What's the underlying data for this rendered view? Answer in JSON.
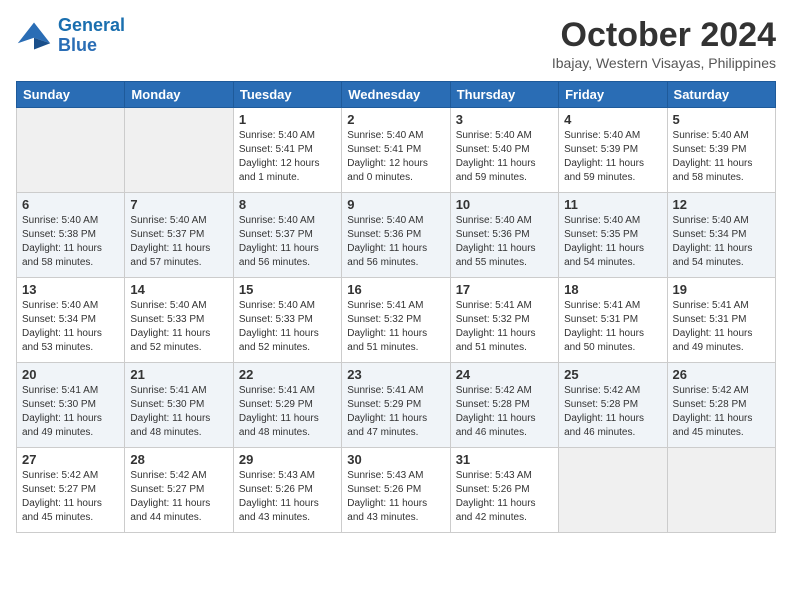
{
  "logo": {
    "line1": "General",
    "line2": "Blue"
  },
  "title": "October 2024",
  "location": "Ibajay, Western Visayas, Philippines",
  "days_of_week": [
    "Sunday",
    "Monday",
    "Tuesday",
    "Wednesday",
    "Thursday",
    "Friday",
    "Saturday"
  ],
  "weeks": [
    [
      {
        "day": "",
        "empty": true
      },
      {
        "day": "",
        "empty": true
      },
      {
        "day": "1",
        "sunrise": "Sunrise: 5:40 AM",
        "sunset": "Sunset: 5:41 PM",
        "daylight": "Daylight: 12 hours and 1 minute."
      },
      {
        "day": "2",
        "sunrise": "Sunrise: 5:40 AM",
        "sunset": "Sunset: 5:41 PM",
        "daylight": "Daylight: 12 hours and 0 minutes."
      },
      {
        "day": "3",
        "sunrise": "Sunrise: 5:40 AM",
        "sunset": "Sunset: 5:40 PM",
        "daylight": "Daylight: 11 hours and 59 minutes."
      },
      {
        "day": "4",
        "sunrise": "Sunrise: 5:40 AM",
        "sunset": "Sunset: 5:39 PM",
        "daylight": "Daylight: 11 hours and 59 minutes."
      },
      {
        "day": "5",
        "sunrise": "Sunrise: 5:40 AM",
        "sunset": "Sunset: 5:39 PM",
        "daylight": "Daylight: 11 hours and 58 minutes."
      }
    ],
    [
      {
        "day": "6",
        "sunrise": "Sunrise: 5:40 AM",
        "sunset": "Sunset: 5:38 PM",
        "daylight": "Daylight: 11 hours and 58 minutes."
      },
      {
        "day": "7",
        "sunrise": "Sunrise: 5:40 AM",
        "sunset": "Sunset: 5:37 PM",
        "daylight": "Daylight: 11 hours and 57 minutes."
      },
      {
        "day": "8",
        "sunrise": "Sunrise: 5:40 AM",
        "sunset": "Sunset: 5:37 PM",
        "daylight": "Daylight: 11 hours and 56 minutes."
      },
      {
        "day": "9",
        "sunrise": "Sunrise: 5:40 AM",
        "sunset": "Sunset: 5:36 PM",
        "daylight": "Daylight: 11 hours and 56 minutes."
      },
      {
        "day": "10",
        "sunrise": "Sunrise: 5:40 AM",
        "sunset": "Sunset: 5:36 PM",
        "daylight": "Daylight: 11 hours and 55 minutes."
      },
      {
        "day": "11",
        "sunrise": "Sunrise: 5:40 AM",
        "sunset": "Sunset: 5:35 PM",
        "daylight": "Daylight: 11 hours and 54 minutes."
      },
      {
        "day": "12",
        "sunrise": "Sunrise: 5:40 AM",
        "sunset": "Sunset: 5:34 PM",
        "daylight": "Daylight: 11 hours and 54 minutes."
      }
    ],
    [
      {
        "day": "13",
        "sunrise": "Sunrise: 5:40 AM",
        "sunset": "Sunset: 5:34 PM",
        "daylight": "Daylight: 11 hours and 53 minutes."
      },
      {
        "day": "14",
        "sunrise": "Sunrise: 5:40 AM",
        "sunset": "Sunset: 5:33 PM",
        "daylight": "Daylight: 11 hours and 52 minutes."
      },
      {
        "day": "15",
        "sunrise": "Sunrise: 5:40 AM",
        "sunset": "Sunset: 5:33 PM",
        "daylight": "Daylight: 11 hours and 52 minutes."
      },
      {
        "day": "16",
        "sunrise": "Sunrise: 5:41 AM",
        "sunset": "Sunset: 5:32 PM",
        "daylight": "Daylight: 11 hours and 51 minutes."
      },
      {
        "day": "17",
        "sunrise": "Sunrise: 5:41 AM",
        "sunset": "Sunset: 5:32 PM",
        "daylight": "Daylight: 11 hours and 51 minutes."
      },
      {
        "day": "18",
        "sunrise": "Sunrise: 5:41 AM",
        "sunset": "Sunset: 5:31 PM",
        "daylight": "Daylight: 11 hours and 50 minutes."
      },
      {
        "day": "19",
        "sunrise": "Sunrise: 5:41 AM",
        "sunset": "Sunset: 5:31 PM",
        "daylight": "Daylight: 11 hours and 49 minutes."
      }
    ],
    [
      {
        "day": "20",
        "sunrise": "Sunrise: 5:41 AM",
        "sunset": "Sunset: 5:30 PM",
        "daylight": "Daylight: 11 hours and 49 minutes."
      },
      {
        "day": "21",
        "sunrise": "Sunrise: 5:41 AM",
        "sunset": "Sunset: 5:30 PM",
        "daylight": "Daylight: 11 hours and 48 minutes."
      },
      {
        "day": "22",
        "sunrise": "Sunrise: 5:41 AM",
        "sunset": "Sunset: 5:29 PM",
        "daylight": "Daylight: 11 hours and 48 minutes."
      },
      {
        "day": "23",
        "sunrise": "Sunrise: 5:41 AM",
        "sunset": "Sunset: 5:29 PM",
        "daylight": "Daylight: 11 hours and 47 minutes."
      },
      {
        "day": "24",
        "sunrise": "Sunrise: 5:42 AM",
        "sunset": "Sunset: 5:28 PM",
        "daylight": "Daylight: 11 hours and 46 minutes."
      },
      {
        "day": "25",
        "sunrise": "Sunrise: 5:42 AM",
        "sunset": "Sunset: 5:28 PM",
        "daylight": "Daylight: 11 hours and 46 minutes."
      },
      {
        "day": "26",
        "sunrise": "Sunrise: 5:42 AM",
        "sunset": "Sunset: 5:28 PM",
        "daylight": "Daylight: 11 hours and 45 minutes."
      }
    ],
    [
      {
        "day": "27",
        "sunrise": "Sunrise: 5:42 AM",
        "sunset": "Sunset: 5:27 PM",
        "daylight": "Daylight: 11 hours and 45 minutes."
      },
      {
        "day": "28",
        "sunrise": "Sunrise: 5:42 AM",
        "sunset": "Sunset: 5:27 PM",
        "daylight": "Daylight: 11 hours and 44 minutes."
      },
      {
        "day": "29",
        "sunrise": "Sunrise: 5:43 AM",
        "sunset": "Sunset: 5:26 PM",
        "daylight": "Daylight: 11 hours and 43 minutes."
      },
      {
        "day": "30",
        "sunrise": "Sunrise: 5:43 AM",
        "sunset": "Sunset: 5:26 PM",
        "daylight": "Daylight: 11 hours and 43 minutes."
      },
      {
        "day": "31",
        "sunrise": "Sunrise: 5:43 AM",
        "sunset": "Sunset: 5:26 PM",
        "daylight": "Daylight: 11 hours and 42 minutes."
      },
      {
        "day": "",
        "empty": true
      },
      {
        "day": "",
        "empty": true
      }
    ]
  ]
}
